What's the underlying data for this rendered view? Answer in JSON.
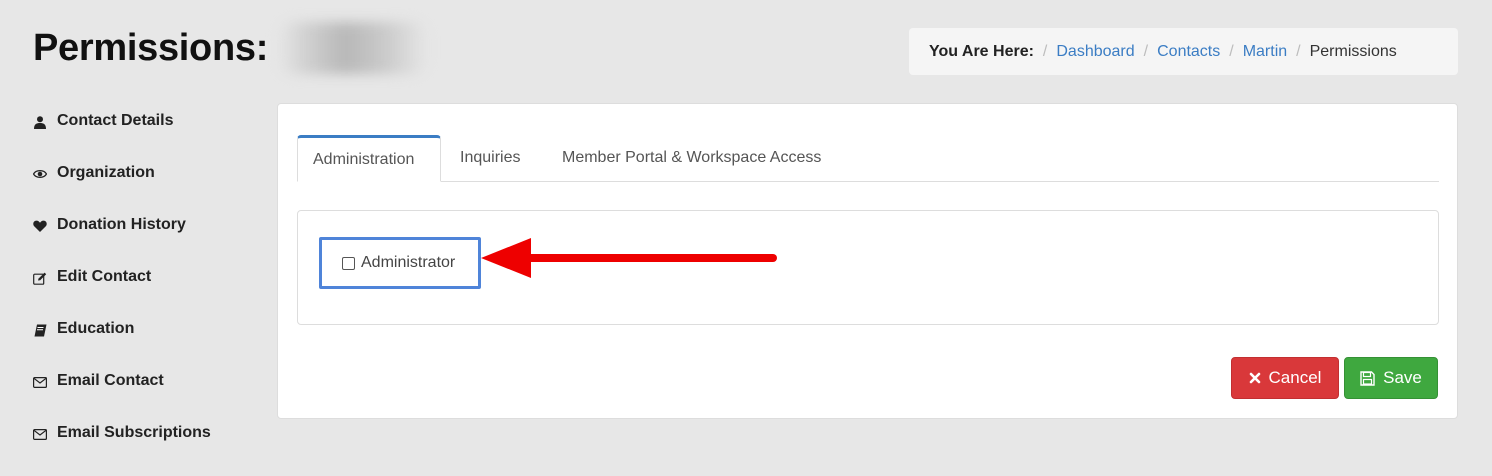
{
  "page": {
    "title": "Permissions:"
  },
  "breadcrumb": {
    "label": "You Are Here:",
    "separator": "/",
    "items": [
      "Dashboard",
      "Contacts",
      "Martin"
    ],
    "current": "Permissions"
  },
  "sidebar": {
    "items": [
      {
        "label": "Contact Details",
        "icon": "user-icon"
      },
      {
        "label": "Organization",
        "icon": "eye-icon"
      },
      {
        "label": "Donation History",
        "icon": "heart-icon"
      },
      {
        "label": "Edit Contact",
        "icon": "edit-icon"
      },
      {
        "label": "Education",
        "icon": "book-icon"
      },
      {
        "label": "Email Contact",
        "icon": "envelope-icon"
      },
      {
        "label": "Email Subscriptions",
        "icon": "envelope-icon"
      }
    ]
  },
  "tabs": [
    {
      "label": "Administration",
      "active": true
    },
    {
      "label": "Inquiries",
      "active": false
    },
    {
      "label": "Member Portal & Workspace Access",
      "active": false
    }
  ],
  "permissions": {
    "administrator": {
      "label": "Administrator",
      "checked": false
    }
  },
  "buttons": {
    "cancel": "Cancel",
    "save": "Save"
  },
  "colors": {
    "link": "#3b7dc4",
    "cancel": "#d9383a",
    "save": "#3fa83f",
    "highlight": "#4f84d9",
    "arrow": "#ee0000"
  }
}
